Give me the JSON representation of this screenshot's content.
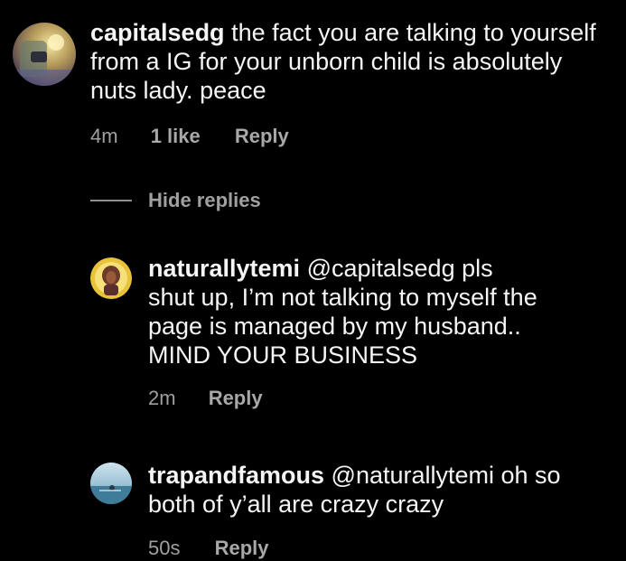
{
  "comments": [
    {
      "username": "capitalsedg",
      "text": "the fact you are talking to yourself from a IG for your unborn child is absolutely nuts lady. peace",
      "time": "4m",
      "likes": "1 like",
      "reply_label": "Reply"
    }
  ],
  "thread": {
    "toggle_label": "Hide replies"
  },
  "replies": [
    {
      "username": "naturallytemi",
      "text": "@capitalsedg pls shut up, I’m not talking to myself the page is managed by my husband.. MIND YOUR BUSINESS",
      "time": "2m",
      "reply_label": "Reply"
    },
    {
      "username": "trapandfamous",
      "text": "@naturallytemi oh so both of y’all are crazy crazy",
      "time": "50s",
      "reply_label": "Reply"
    }
  ],
  "colors": {
    "background": "#000000",
    "primary_text": "#f5f5f5",
    "secondary_text": "#a0a0a0"
  }
}
